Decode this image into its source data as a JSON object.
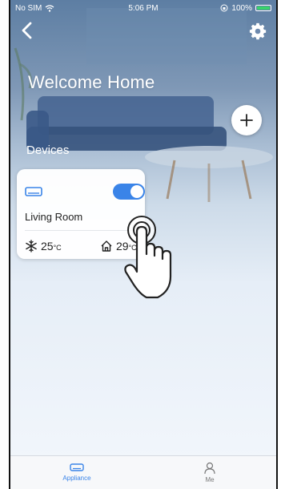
{
  "status_bar": {
    "carrier": "No SIM",
    "time": "5:06 PM",
    "battery_percent": "100%",
    "battery_level": 1.0
  },
  "header": {
    "back_icon": "chevron-left-icon",
    "settings_icon": "gear-icon",
    "title": "Welcome Home",
    "add_icon": "plus-icon"
  },
  "devices": {
    "section_label": "Devices",
    "items": [
      {
        "icon": "air-conditioner-icon",
        "name": "Living Room",
        "power_on": true,
        "set_temperature": "25",
        "set_temperature_unit": "°C",
        "indoor_temperature": "29",
        "indoor_temperature_unit": "°C"
      }
    ]
  },
  "tabbar": {
    "tabs": [
      {
        "label": "Appliance",
        "icon": "appliance-icon",
        "active": true
      },
      {
        "label": "Me",
        "icon": "person-icon",
        "active": false
      }
    ]
  },
  "colors": {
    "accent": "#3a84e8",
    "toggle_on": "#3a84e8",
    "battery": "#38d36b"
  }
}
